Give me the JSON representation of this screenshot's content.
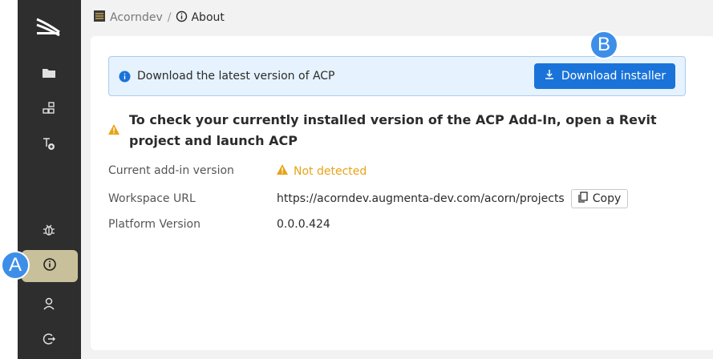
{
  "breadcrumb": {
    "home": "Acorndev",
    "separator": "/",
    "current": "About"
  },
  "banner": {
    "text": "Download the latest version of ACP",
    "button_label": "Download installer"
  },
  "notice": {
    "text": "To check your currently installed version of the ACP Add-In, open a Revit project and launch ACP"
  },
  "details": [
    {
      "label": "Current add-in version",
      "value": "Not detected"
    },
    {
      "label": "Workspace URL",
      "value": "https://acorndev.augmenta-dev.com/acorn/projects",
      "copy_label": "Copy"
    },
    {
      "label": "Platform Version",
      "value": "0.0.0.424"
    }
  ],
  "markers": {
    "a": "A",
    "b": "B"
  },
  "colors": {
    "accent": "#1a73d9",
    "warning": "#e8a317",
    "sidebar": "#2e2e2e",
    "active_nav": "#c8c09a",
    "marker": "#3d8ee8"
  },
  "icons": {
    "sidebar": [
      "logo-waves-icon",
      "folder-icon",
      "hierarchy-icon",
      "add-tree-icon",
      "bug-icon",
      "info-icon",
      "user-icon",
      "logout-icon"
    ]
  }
}
